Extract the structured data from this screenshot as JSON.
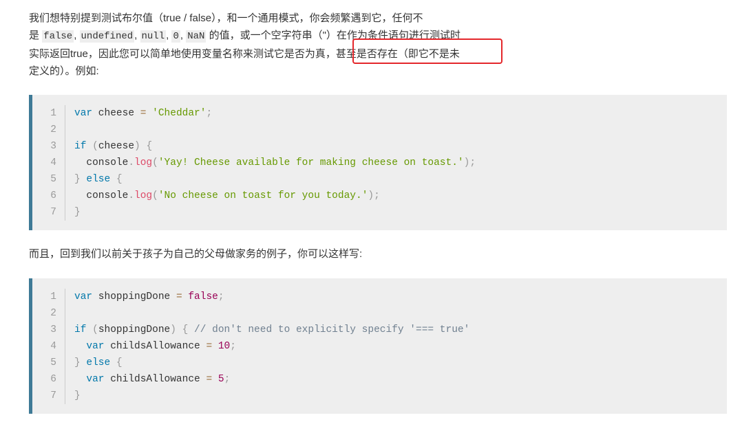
{
  "intro": {
    "line1": "我们想特别提到测试布尔值（true / false），和一个通用模式，你会频繁遇到它，任何不",
    "line2_prefix": "是 ",
    "inline_codes": [
      "false",
      "undefined",
      "null",
      "0",
      "NaN"
    ],
    "line2_suffix": " 的值，或一个空字符串（\"）在作为条件语句进行测试时",
    "line3_a": "实际返回true，因此您可以简单地使用变量名称来测试它是否为真，",
    "line3_highlight": "甚至是否存在（即它不是未",
    "line4": "定义的）。例如:"
  },
  "highlight_color": "#e4262a",
  "code_block_1": {
    "lines": [
      [
        [
          "kw",
          "var"
        ],
        [
          "id",
          " cheese "
        ],
        [
          "op",
          "="
        ],
        [
          "id",
          " "
        ],
        [
          "str",
          "'Cheddar'"
        ],
        [
          "p",
          ";"
        ]
      ],
      [],
      [
        [
          "kw",
          "if"
        ],
        [
          "id",
          " "
        ],
        [
          "p",
          "("
        ],
        [
          "id",
          "cheese"
        ],
        [
          "p",
          ")"
        ],
        [
          "id",
          " "
        ],
        [
          "p",
          "{"
        ]
      ],
      [
        [
          "id",
          "  console"
        ],
        [
          "p",
          "."
        ],
        [
          "fn",
          "log"
        ],
        [
          "p",
          "("
        ],
        [
          "str",
          "'Yay! Cheese available for making cheese on toast.'"
        ],
        [
          "p",
          ");"
        ]
      ],
      [
        [
          "p",
          "}"
        ],
        [
          "id",
          " "
        ],
        [
          "kw",
          "else"
        ],
        [
          "id",
          " "
        ],
        [
          "p",
          "{"
        ]
      ],
      [
        [
          "id",
          "  console"
        ],
        [
          "p",
          "."
        ],
        [
          "fn",
          "log"
        ],
        [
          "p",
          "("
        ],
        [
          "str",
          "'No cheese on toast for you today.'"
        ],
        [
          "p",
          ");"
        ]
      ],
      [
        [
          "p",
          "}"
        ]
      ]
    ]
  },
  "middle_text": "而且，回到我们以前关于孩子为自己的父母做家务的例子，你可以这样写:",
  "code_block_2": {
    "lines": [
      [
        [
          "kw",
          "var"
        ],
        [
          "id",
          " shoppingDone "
        ],
        [
          "op",
          "="
        ],
        [
          "id",
          " "
        ],
        [
          "num",
          "false"
        ],
        [
          "p",
          ";"
        ]
      ],
      [],
      [
        [
          "kw",
          "if"
        ],
        [
          "id",
          " "
        ],
        [
          "p",
          "("
        ],
        [
          "id",
          "shoppingDone"
        ],
        [
          "p",
          ")"
        ],
        [
          "id",
          " "
        ],
        [
          "p",
          "{"
        ],
        [
          "id",
          " "
        ],
        [
          "cm",
          "// don't need to explicitly specify '=== true'"
        ]
      ],
      [
        [
          "id",
          "  "
        ],
        [
          "kw",
          "var"
        ],
        [
          "id",
          " childsAllowance "
        ],
        [
          "op",
          "="
        ],
        [
          "id",
          " "
        ],
        [
          "num",
          "10"
        ],
        [
          "p",
          ";"
        ]
      ],
      [
        [
          "p",
          "}"
        ],
        [
          "id",
          " "
        ],
        [
          "kw",
          "else"
        ],
        [
          "id",
          " "
        ],
        [
          "p",
          "{"
        ]
      ],
      [
        [
          "id",
          "  "
        ],
        [
          "kw",
          "var"
        ],
        [
          "id",
          " childsAllowance "
        ],
        [
          "op",
          "="
        ],
        [
          "id",
          " "
        ],
        [
          "num",
          "5"
        ],
        [
          "p",
          ";"
        ]
      ],
      [
        [
          "p",
          "}"
        ]
      ]
    ]
  }
}
